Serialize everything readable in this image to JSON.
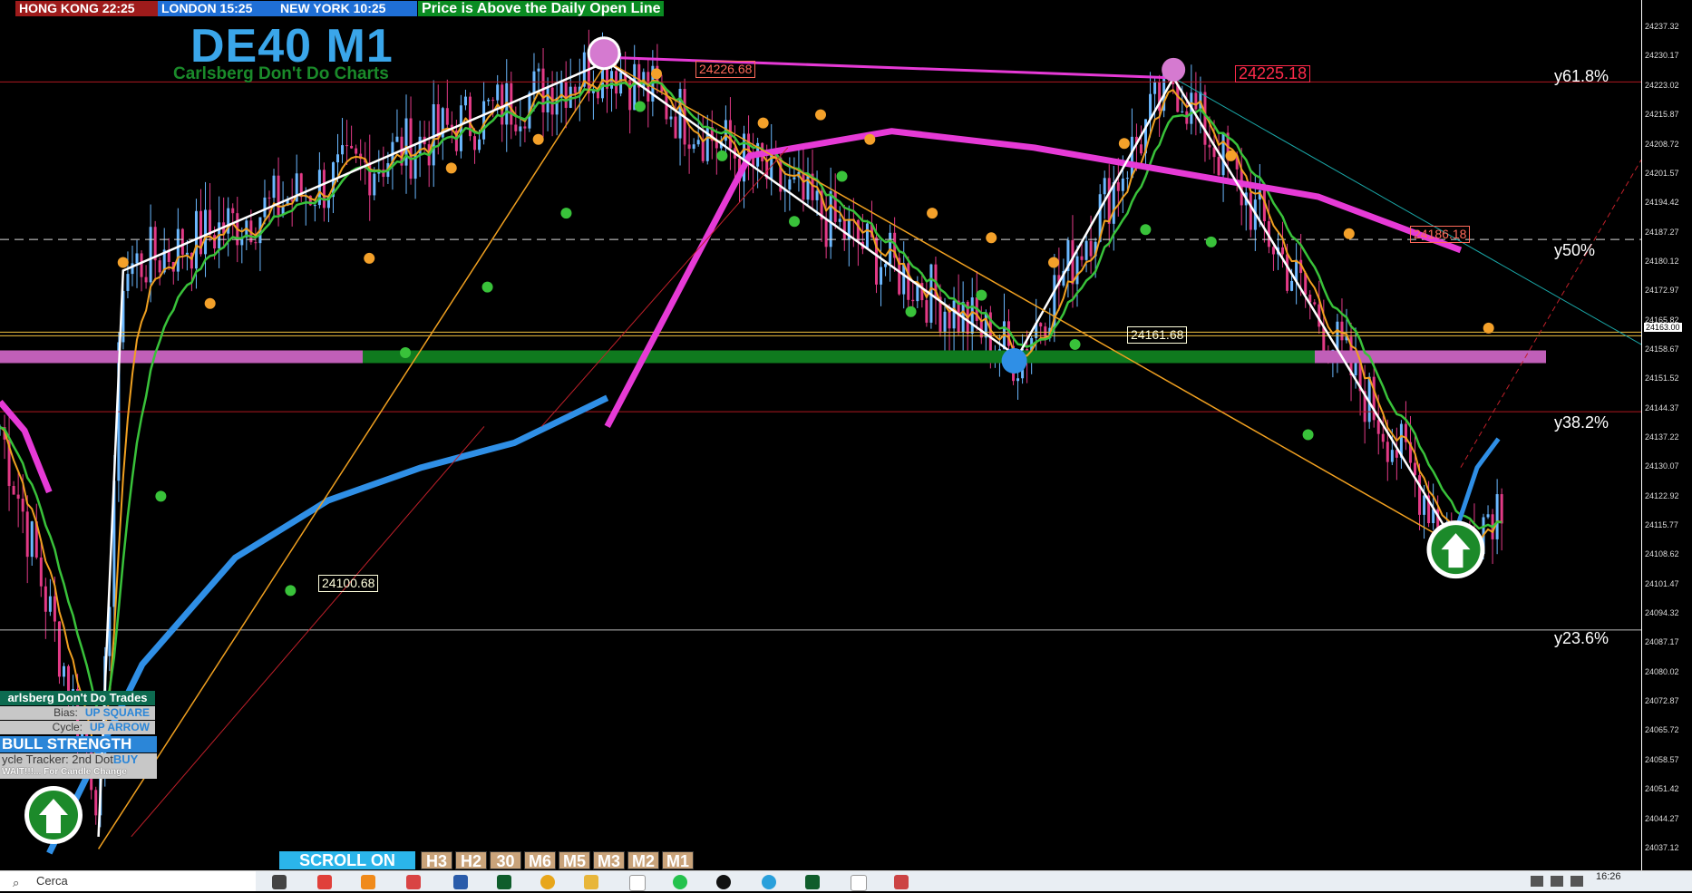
{
  "clocks": {
    "hk": "HONG KONG 22:25",
    "london": "LONDON  15:25",
    "ny": "NEW YORK  10:25"
  },
  "status_text": "Price is Above the Daily Open Line",
  "title": "DE40 M1",
  "subtitle": "Carlsberg Don't Do Charts",
  "panel": {
    "header": "arlsberg Don't Do Trades",
    "bias_label": "Bias:",
    "bias_value": "UP SQUARE",
    "cycle_label": "Cycle:",
    "cycle_value": "UP ARROW",
    "strength": "BULL STRENGTH",
    "tracker_label": "ycle Tracker: 2nd Dot",
    "tracker_value": "BUY",
    "wait_text": "WAIT!!!... For Candle Change"
  },
  "timeframes": {
    "scroll": "SCROLL ON",
    "buttons": [
      "H3",
      "H2",
      "30",
      "M6",
      "M5",
      "M3",
      "M2",
      "M1"
    ]
  },
  "fib_levels": {
    "f618": "y61.8%",
    "f50": "y50%",
    "f382": "y38.2%",
    "f236": "y23.6%"
  },
  "price_labels": {
    "high1": "24226.68",
    "high2": "24225.18",
    "mid": "24186.18",
    "low1": "24161.68",
    "low2": "24100.68",
    "current": "24163.00"
  },
  "taskbar": {
    "search_placeholder": "Cerca",
    "time": "16:26"
  },
  "colors": {
    "candle_up": "#6bb8ff",
    "candle_down": "#e23a86",
    "ma_fast": "#f0a020",
    "ma_mid": "#39c23a",
    "ma_slow_blue": "#2f8fe6",
    "ma_slow_magenta": "#e63ad6",
    "zigzag": "#ffffff"
  },
  "chart_data": {
    "type": "line",
    "symbol": "DE40",
    "timeframe": "M1",
    "y_ticks": [
      "24237.32",
      "24230.17",
      "24223.02",
      "24215.87",
      "24208.72",
      "24201.57",
      "24194.42",
      "24187.27",
      "24180.12",
      "24172.97",
      "24165.82",
      "24158.67",
      "24151.52",
      "24144.37",
      "24137.22",
      "24130.07",
      "24122.92",
      "24115.77",
      "24108.62",
      "24101.47",
      "24094.32",
      "24087.17",
      "24080.02",
      "24072.87",
      "24065.72",
      "24058.57",
      "24051.42",
      "24044.27",
      "24037.12"
    ],
    "ylim": [
      24034.0,
      24240.0
    ],
    "fib_levels": [
      {
        "label": "y61.8%",
        "price": 24224.0
      },
      {
        "label": "y50%",
        "price": 24185.6
      },
      {
        "label": "y38.2%",
        "price": 24143.6
      },
      {
        "label": "y23.6%",
        "price": 24090.4
      }
    ],
    "zigzag_points": [
      {
        "x": 0.06,
        "price": 24040.0
      },
      {
        "x": 0.075,
        "price": 24178.0
      },
      {
        "x": 0.37,
        "price": 24229.0
      },
      {
        "x": 0.62,
        "price": 24157.0
      },
      {
        "x": 0.715,
        "price": 24225.0
      },
      {
        "x": 0.887,
        "price": 24111.0
      }
    ],
    "ma_series": [
      {
        "name": "ma_slow_blue",
        "values": [
          24036,
          24082,
          24108,
          24122,
          24130,
          24136,
          24147
        ]
      },
      {
        "name": "ma_slow_magenta",
        "values": [
          24140,
          24206,
          24212,
          24208,
          24202,
          24196,
          24183
        ]
      }
    ],
    "daily_open_price": 24157.0,
    "current_price": 24163.0
  }
}
